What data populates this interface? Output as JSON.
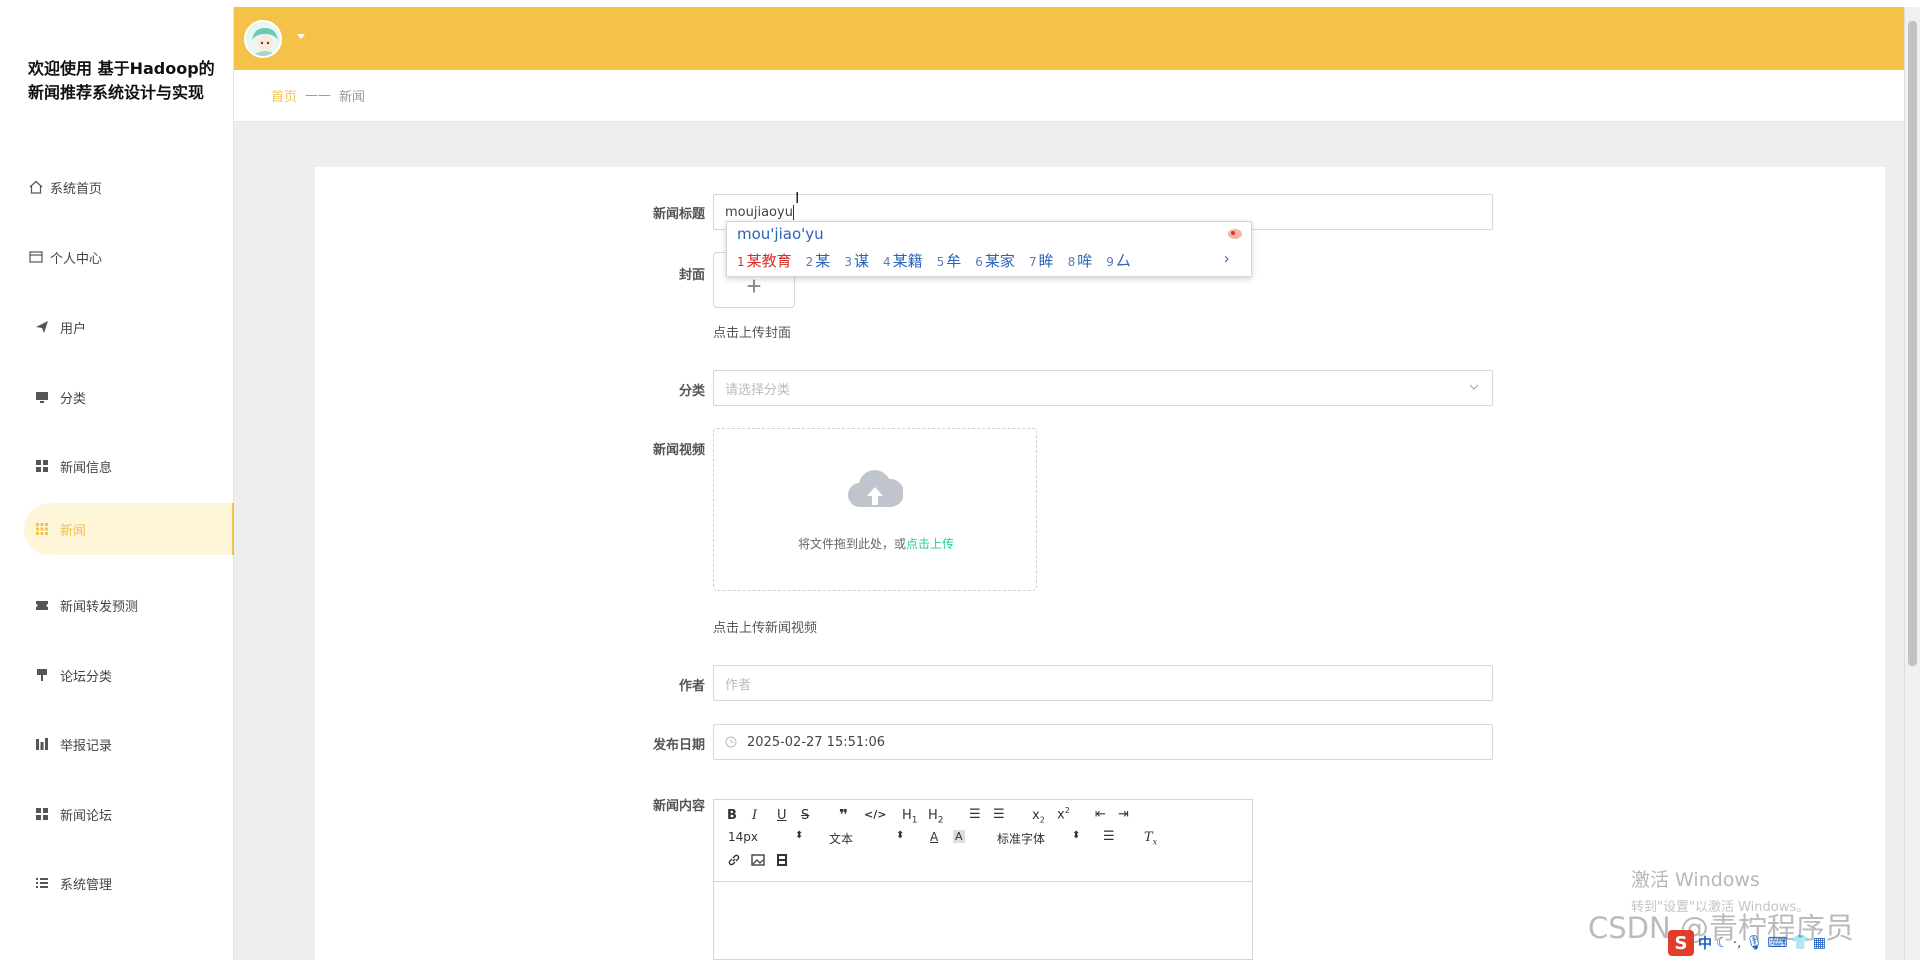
{
  "brand": {
    "title": "欢迎使用 基于Hadoop的新闻推荐系统设计与实现"
  },
  "sidebar": {
    "items": [
      {
        "label": "系统首页",
        "icon": "home-icon"
      },
      {
        "label": "个人中心",
        "icon": "profile-icon"
      },
      {
        "label": "用户",
        "icon": "send-icon"
      },
      {
        "label": "分类",
        "icon": "monitor-icon"
      },
      {
        "label": "新闻信息",
        "icon": "grid-icon"
      },
      {
        "label": "新闻",
        "icon": "grid-dots-icon",
        "active": true
      },
      {
        "label": "新闻转发预测",
        "icon": "ticket-icon"
      },
      {
        "label": "论坛分类",
        "icon": "signpost-icon"
      },
      {
        "label": "举报记录",
        "icon": "bar-chart-icon"
      },
      {
        "label": "新闻论坛",
        "icon": "grid-icon"
      },
      {
        "label": "系统管理",
        "icon": "list-icon"
      }
    ]
  },
  "breadcrumb": {
    "home": "首页",
    "separator": "——",
    "current": "新闻"
  },
  "form": {
    "title_label": "新闻标题",
    "title_value": "moujiaoyu",
    "cover_label": "封面",
    "cover_hint": "点击上传封面",
    "category_label": "分类",
    "category_placeholder": "请选择分类",
    "video_label": "新闻视频",
    "video_drop_text": "将文件拖到此处，或",
    "video_drop_link": "点击上传",
    "video_hint": "点击上传新闻视频",
    "author_label": "作者",
    "author_placeholder": "作者",
    "date_label": "发布日期",
    "date_value": "2025-02-27 15:51:06",
    "content_label": "新闻内容"
  },
  "editor": {
    "font_size": "14px",
    "text_style": "文本",
    "font_family": "标准字体",
    "buttons": [
      "B",
      "I",
      "U",
      "S",
      "99",
      "</>",
      "H1",
      "H2",
      "list-ordered",
      "list-bullet",
      "x2",
      "x2",
      "outdent",
      "indent"
    ]
  },
  "ime": {
    "pinyin": "mou'jiao'yu",
    "candidates": [
      {
        "n": "1",
        "text": "某教育"
      },
      {
        "n": "2",
        "text": "某"
      },
      {
        "n": "3",
        "text": "谋"
      },
      {
        "n": "4",
        "text": "某籍"
      },
      {
        "n": "5",
        "text": "牟"
      },
      {
        "n": "6",
        "text": "某家"
      },
      {
        "n": "7",
        "text": "眸"
      },
      {
        "n": "8",
        "text": "哞"
      },
      {
        "n": "9",
        "text": "厶"
      }
    ]
  },
  "overlay": {
    "windows_activate_title": "激活 Windows",
    "windows_activate_sub": "转到\"设置\"以激活 Windows。",
    "watermark": "CSDN @青柠程序员",
    "tray_text": "中"
  },
  "colors": {
    "accent": "#f5c249",
    "link": "#29c7a1",
    "active_bg": "#fff5d9"
  }
}
